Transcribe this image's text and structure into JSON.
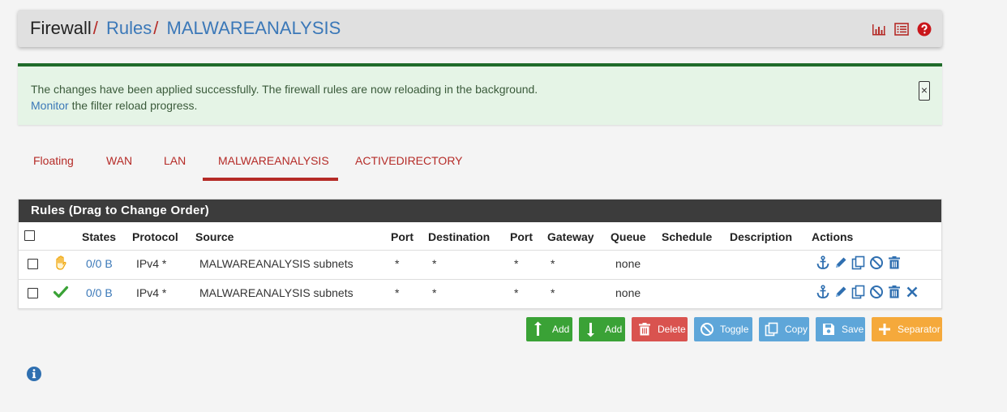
{
  "breadcrumb": {
    "items": [
      "Firewall",
      "Rules",
      "MALWAREANALYSIS"
    ],
    "separator": "/"
  },
  "header_icons": [
    "bar-chart-icon",
    "list-icon",
    "help-icon"
  ],
  "alert": {
    "line1": "The changes have been applied successfully. The firewall rules are now reloading in the background.",
    "link": "Monitor",
    "line2_rest": " the filter reload progress.",
    "close": "×"
  },
  "tabs": [
    {
      "label": "Floating"
    },
    {
      "label": "WAN"
    },
    {
      "label": "LAN"
    },
    {
      "label": "MALWAREANALYSIS",
      "active": true
    },
    {
      "label": "ACTIVEDIRECTORY"
    }
  ],
  "panel": {
    "title": "Rules (Drag to Change Order)",
    "columns": [
      "States",
      "Protocol",
      "Source",
      "Port",
      "Destination",
      "Port",
      "Gateway",
      "Queue",
      "Schedule",
      "Description",
      "Actions"
    ]
  },
  "rows": [
    {
      "status_icon": "hand-icon",
      "states": "0/0 B",
      "protocol": "IPv4 *",
      "source": "MALWAREANALYSIS subnets",
      "src_port": "*",
      "destination": "*",
      "dst_port": "*",
      "gateway": "*",
      "queue": "none",
      "schedule": "",
      "description": "",
      "actions": [
        "anchor-icon",
        "edit-icon",
        "copy-icon",
        "disable-icon",
        "delete-icon"
      ]
    },
    {
      "status_icon": "check-icon",
      "states": "0/0 B",
      "protocol": "IPv4 *",
      "source": "MALWAREANALYSIS subnets",
      "src_port": "*",
      "destination": "*",
      "dst_port": "*",
      "gateway": "*",
      "queue": "none",
      "schedule": "",
      "description": "",
      "actions": [
        "anchor-icon",
        "edit-icon",
        "copy-icon",
        "disable-icon",
        "delete-icon",
        "remove-icon"
      ]
    }
  ],
  "buttons": {
    "add_top": "Add",
    "add_bottom": "Add",
    "delete": "Delete",
    "toggle": "Toggle",
    "copy": "Copy",
    "save": "Save",
    "separator": "Separator"
  },
  "colors": {
    "accent_red": "#b52b27",
    "link_blue": "#3b78b8",
    "success_green": "#3aa236",
    "panel_header": "#3c3c3c",
    "alert_bg": "#e5f4e6"
  }
}
